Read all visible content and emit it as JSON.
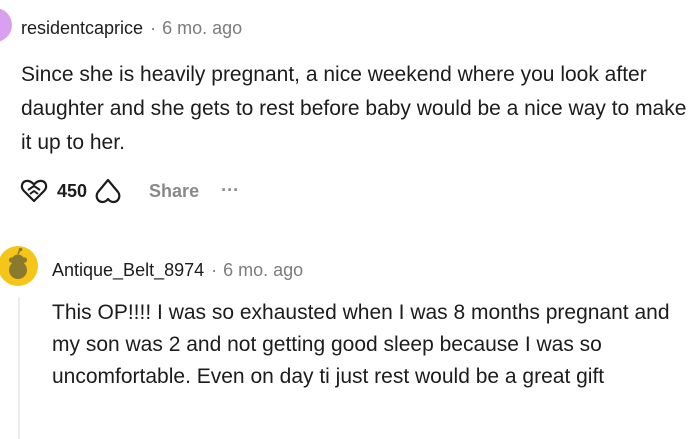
{
  "comments": [
    {
      "author": "residentcaprice",
      "separator": "·",
      "time": "6 mo. ago",
      "body": "Since she is heavily pregnant, a nice weekend where you look after daughter and she gets to rest before baby would be a nice way to make it up to her.",
      "votes": "450",
      "share_label": "Share",
      "more_label": "...",
      "avatar_color": "#d9a0f0"
    },
    {
      "author": "Antique_Belt_8974",
      "separator": "·",
      "time": "6 mo. ago",
      "body": "This OP!!!! I was so exhausted when I was 8 months pregnant and my son was 2 and not getting good sleep because I was so uncomfortable. Even on day ti just rest would be a great gift",
      "avatar_color": "#f5c518"
    }
  ],
  "icons": {
    "upvote": "upvote-heart-icon",
    "downvote": "downvote-heart-icon",
    "more": "more-options-icon",
    "avatar2": "snoo-avatar-icon"
  },
  "colors": {
    "text": "#1c1c1c",
    "meta": "#7c7c7c",
    "action": "#878a8c",
    "thread_line": "#ededed"
  }
}
